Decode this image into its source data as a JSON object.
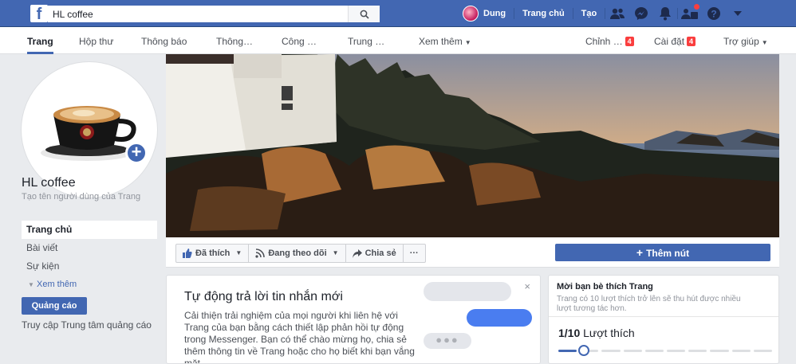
{
  "topbar": {
    "logo": "f",
    "search_value": "HL coffee",
    "user_name": "Dung",
    "home_label": "Trang chủ",
    "create_label": "Tạo"
  },
  "pagenav": {
    "items": [
      "Trang",
      "Hộp thư",
      "Thông báo",
      "Thông…",
      "Công …",
      "Trung …",
      "Xem thêm"
    ],
    "edit_label": "Chỉnh …",
    "edit_badge": "4",
    "settings_label": "Cài đặt",
    "settings_badge": "4",
    "help_label": "Trợ giúp"
  },
  "sidebar": {
    "page_name": "HL coffee",
    "username_hint": "Tạo tên người dùng của Trang",
    "items": [
      "Trang chủ",
      "Bài viết",
      "Sự kiện"
    ],
    "more": "Xem thêm",
    "ad_button": "Quảng cáo",
    "ad_center": "Truy cập Trung tâm quảng cáo"
  },
  "actions": {
    "liked": "Đã thích",
    "following": "Đang theo dõi",
    "share": "Chia sẻ",
    "more": "···",
    "add_button": "Thêm nút"
  },
  "autoreply": {
    "title": "Tự động trả lời tin nhắn mới",
    "body": "Cải thiện trải nghiệm của mọi người khi liên hệ với Trang của bạn bằng cách thiết lập phản hồi tự động trong Messenger. Bạn có thể chào mừng họ, chia sẻ thêm thông tin về Trang hoặc cho họ biết khi bạn vắng mặt.",
    "close": "×"
  },
  "invite": {
    "title": "Mời bạn bè thích Trang",
    "desc": "Trang có 10 lượt thích trở lên sẽ thu hút được nhiều lượt tương tác hơn.",
    "count": "1/10",
    "count_label": "Lượt thích",
    "progress_fraction": 0.1
  },
  "colors": {
    "brand": "#4267b2",
    "badge": "#fa3e3e"
  }
}
